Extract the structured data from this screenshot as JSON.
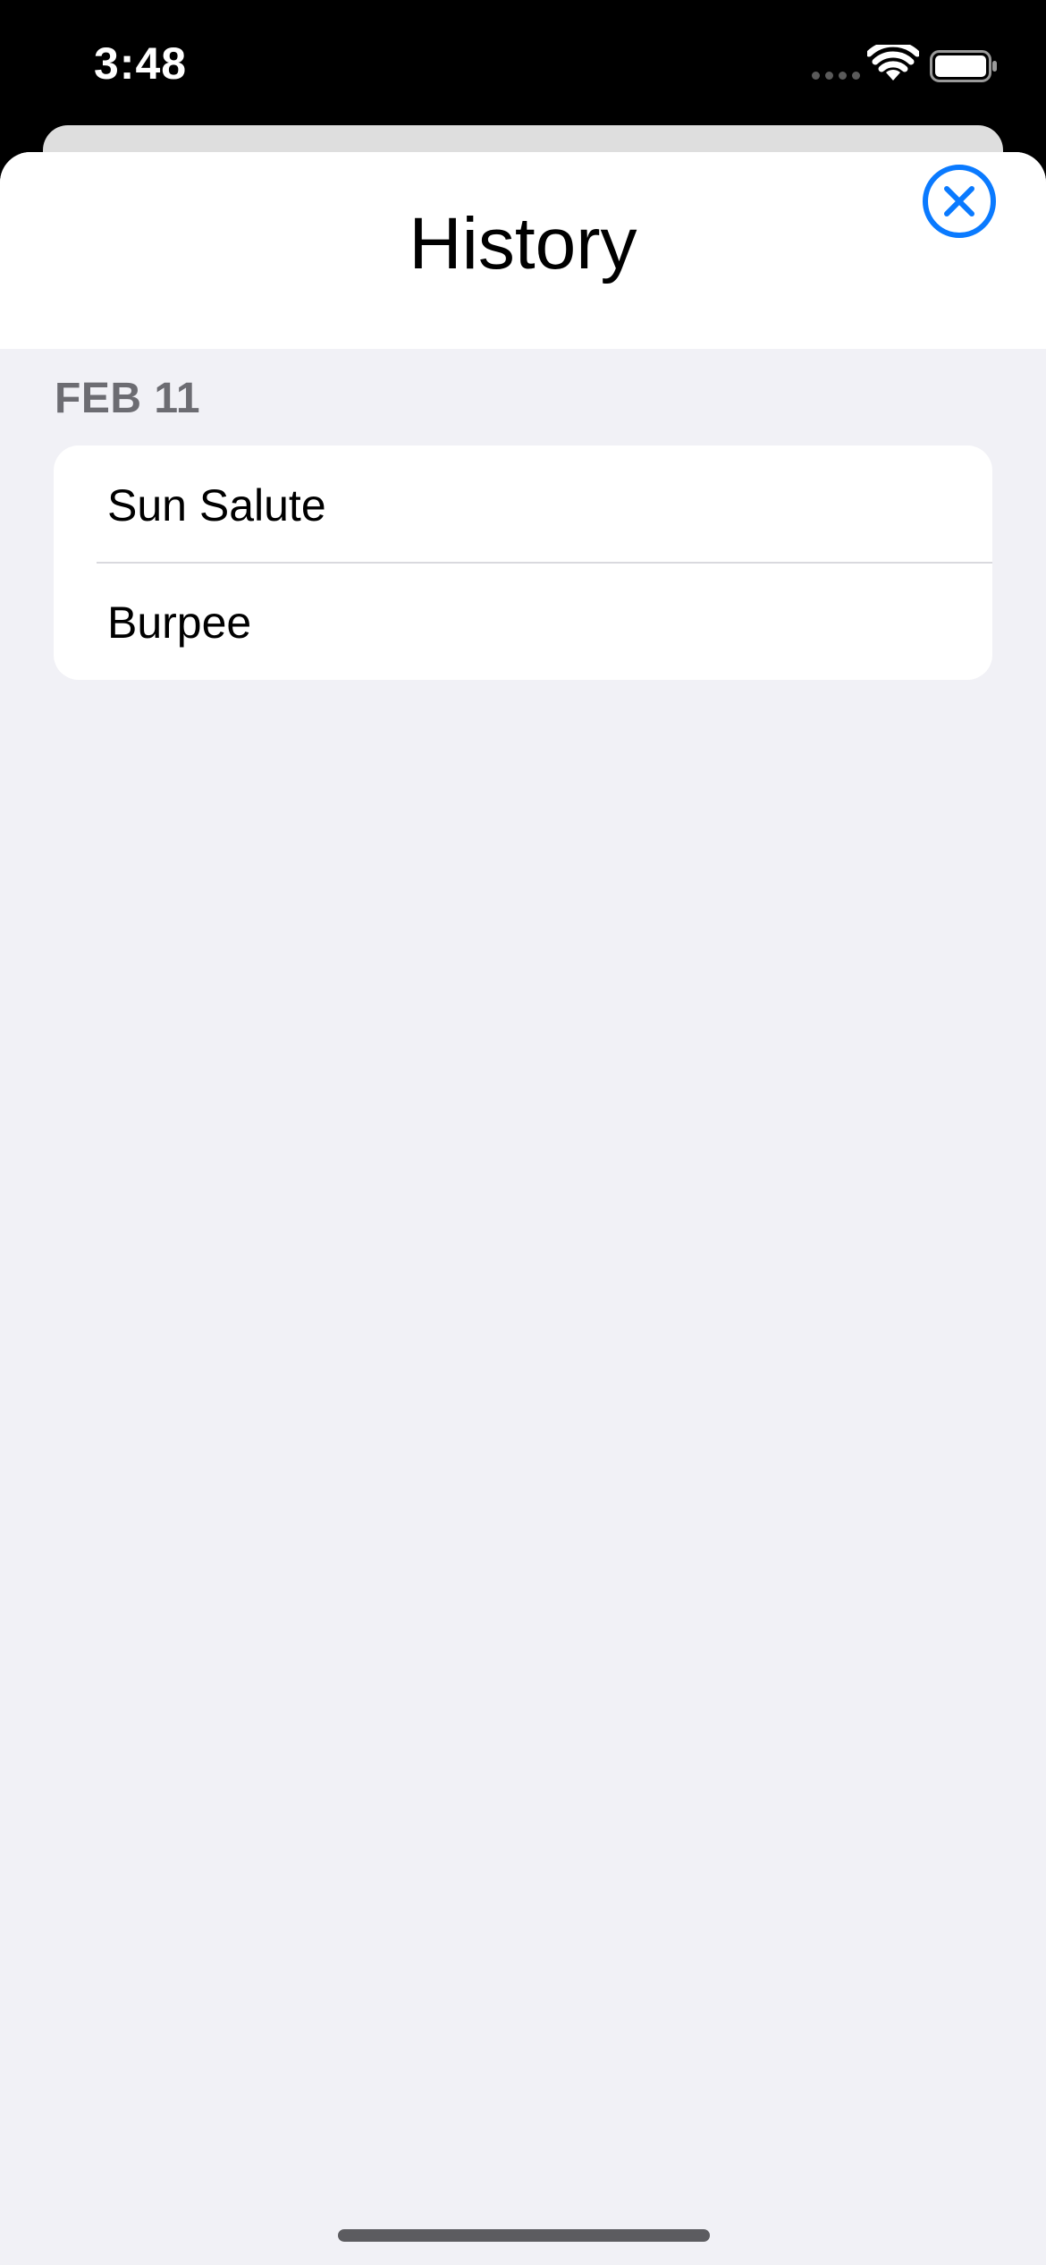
{
  "status_bar": {
    "time": "3:48"
  },
  "sheet": {
    "title": "History",
    "close_icon": "xmark-circle-icon"
  },
  "sections": [
    {
      "header": "FEB 11",
      "items": [
        {
          "label": "Sun Salute"
        },
        {
          "label": "Burpee"
        }
      ]
    }
  ],
  "colors": {
    "accent": "#0a7aff",
    "background": "#f1f1f6",
    "section_header": "#6c6c72"
  }
}
